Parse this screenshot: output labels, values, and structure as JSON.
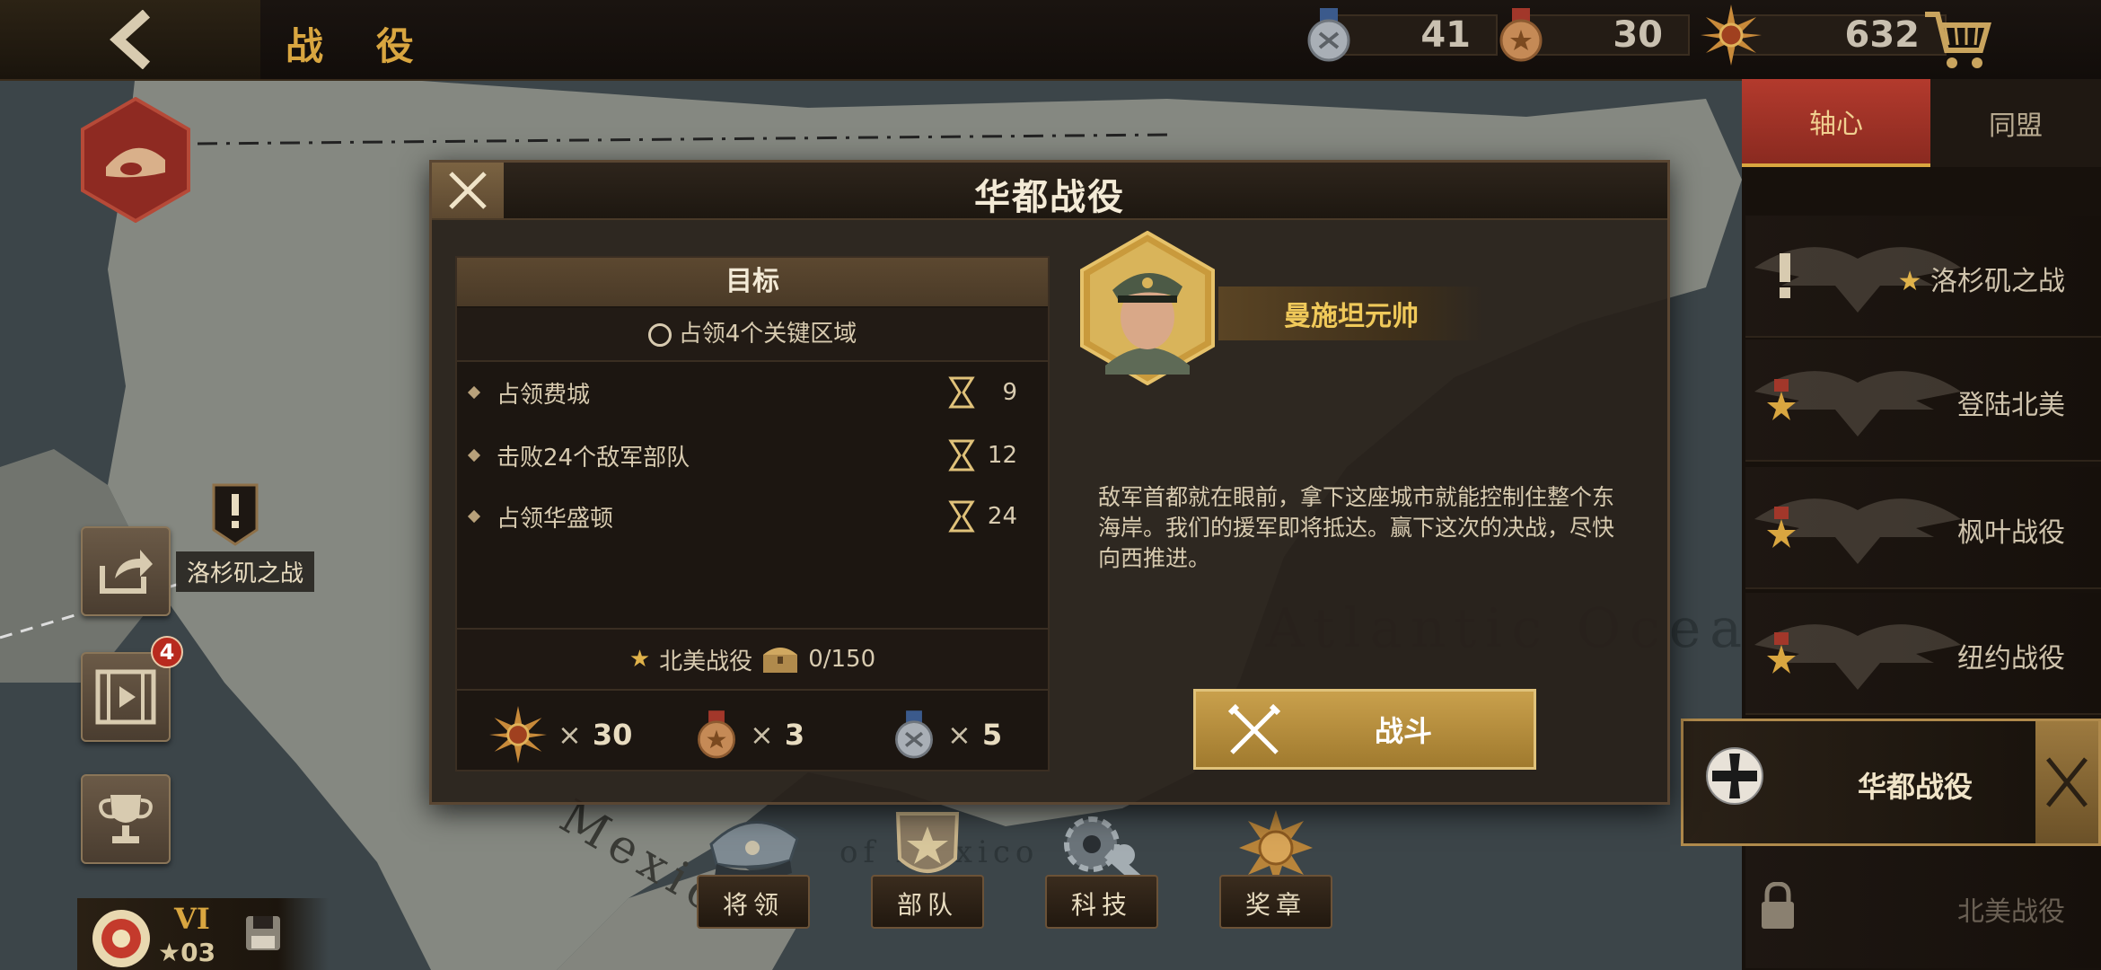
{
  "header": {
    "title": "战 役",
    "resources": [
      {
        "name": "silver-medal",
        "value": "41"
      },
      {
        "name": "bronze-medal",
        "value": "30"
      },
      {
        "name": "gold-star-medal",
        "value": "632"
      }
    ]
  },
  "map": {
    "pin_label": "洛杉矶之战",
    "ocean_label": "Atlantic Ocean",
    "region_label": "Mexico",
    "gulf_label": "of Mexico",
    "faded_labels": [
      "登陆北美",
      "纽约战役"
    ]
  },
  "left_buttons": {
    "video_badge": "4"
  },
  "rank": {
    "roman": "VI",
    "stars": "03"
  },
  "bottom_nav": [
    {
      "label": "将领"
    },
    {
      "label": "部队"
    },
    {
      "label": "科技"
    },
    {
      "label": "奖章"
    }
  ],
  "right_panel": {
    "tabs": [
      "轴心",
      "同盟"
    ],
    "campaigns": [
      {
        "label": "洛杉矶之战",
        "starred": true
      },
      {
        "label": "登陆北美"
      },
      {
        "label": "枫叶战役"
      },
      {
        "label": "纽约战役"
      },
      {
        "label": "华都战役",
        "active": true
      },
      {
        "label": "北美战役",
        "locked": true
      }
    ]
  },
  "dialog": {
    "title": "华都战役",
    "objective_header": "目标",
    "objective_main": "占领4个关键区域",
    "objectives": [
      {
        "text": "占领费城",
        "turns": "9"
      },
      {
        "text": "击败24个敌军部队",
        "turns": "12"
      },
      {
        "text": "占领华盛顿",
        "turns": "24"
      }
    ],
    "campaign_progress": {
      "name": "北美战役",
      "value": "0/150"
    },
    "rewards": [
      {
        "icon": "gold-star-medal",
        "x": "×",
        "count": "30"
      },
      {
        "icon": "bronze-medal",
        "x": "×",
        "count": "3"
      },
      {
        "icon": "silver-medal",
        "x": "×",
        "count": "5"
      }
    ],
    "general_name": "曼施坦元帅",
    "description": "敌军首都就在眼前，拿下这座城市就能控制住整个东海岸。我们的援军即将抵达。赢下这次的决战，尽快向西推进。",
    "fight_label": "战斗"
  },
  "colors": {
    "accent": "#d9a640",
    "axis_tab": "#a8352a",
    "button_gold": "#b8913f"
  }
}
